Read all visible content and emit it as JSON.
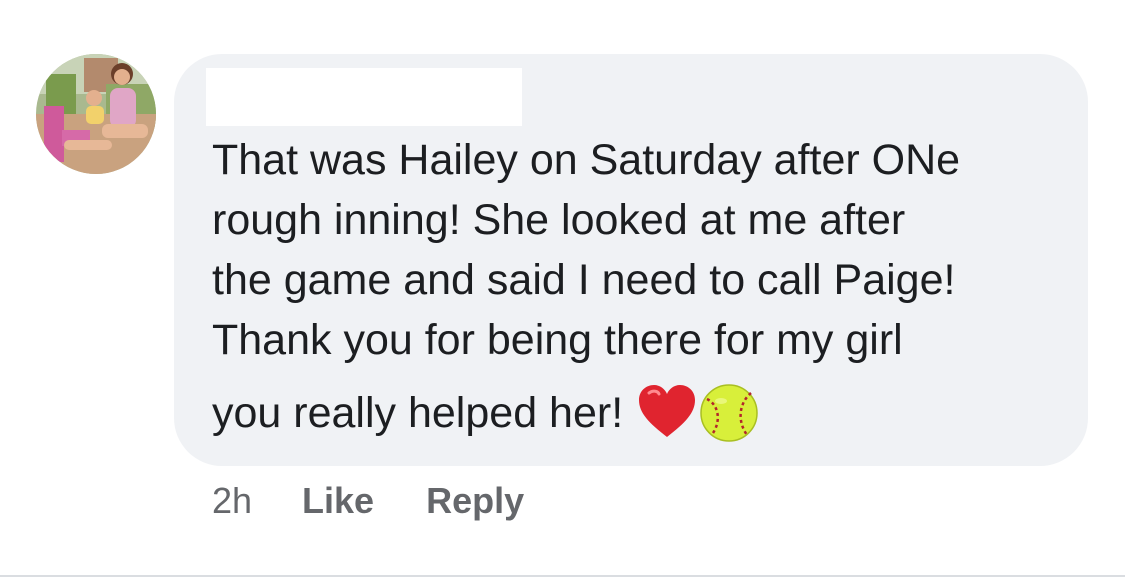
{
  "comment": {
    "text_lines": "That was Hailey on Saturday after ONe\nrough inning! She looked at me after\nthe game and said I need to call Paige!\nThank you for being there for my girl",
    "last_line": "you really helped her!",
    "emojis": [
      "red-heart-icon",
      "softball-icon"
    ],
    "colors": {
      "bubble": "#f0f2f5",
      "text": "#1c1e21",
      "meta": "#65676b",
      "heart": "#e0242f",
      "softball": "#d8ef3a",
      "stitch": "#b3262a"
    }
  },
  "actions": {
    "time": "2h",
    "like_label": "Like",
    "reply_label": "Reply"
  }
}
